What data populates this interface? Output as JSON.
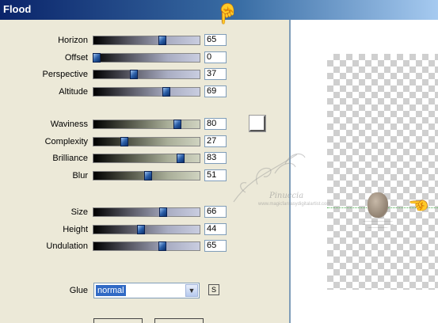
{
  "window": {
    "title": "Flood"
  },
  "groups": [
    {
      "track_style": "dark",
      "sliders": [
        {
          "label": "Horizon",
          "value": "65",
          "level": 65
        },
        {
          "label": "Offset",
          "value": "0",
          "level": 0
        },
        {
          "label": "Perspective",
          "value": "37",
          "level": 37
        },
        {
          "label": "Altitude",
          "value": "69",
          "level": 69
        }
      ]
    },
    {
      "track_style": "olive",
      "sliders": [
        {
          "label": "Waviness",
          "value": "80",
          "level": 80
        },
        {
          "label": "Complexity",
          "value": "27",
          "level": 27
        },
        {
          "label": "Brilliance",
          "value": "83",
          "level": 83
        },
        {
          "label": "Blur",
          "value": "51",
          "level": 51
        }
      ]
    },
    {
      "track_style": "dark",
      "sliders": [
        {
          "label": "Size",
          "value": "66",
          "level": 66
        },
        {
          "label": "Height",
          "value": "44",
          "level": 44
        },
        {
          "label": "Undulation",
          "value": "65",
          "level": 65
        }
      ]
    }
  ],
  "color_swatch": {
    "color": "#ffffff"
  },
  "glue": {
    "label": "Glue",
    "selected": "normal"
  },
  "s_button": {
    "label": "S"
  },
  "icons": {
    "pointer": "pointing-hand-icon"
  },
  "watermark": {
    "line1": "Pinuccia",
    "line2": "www.magicfantasydigitalartist.com"
  },
  "colors": {
    "title_bar": "#0a246a",
    "thumb": "#2c5fa8",
    "selection": "#316ac5"
  }
}
